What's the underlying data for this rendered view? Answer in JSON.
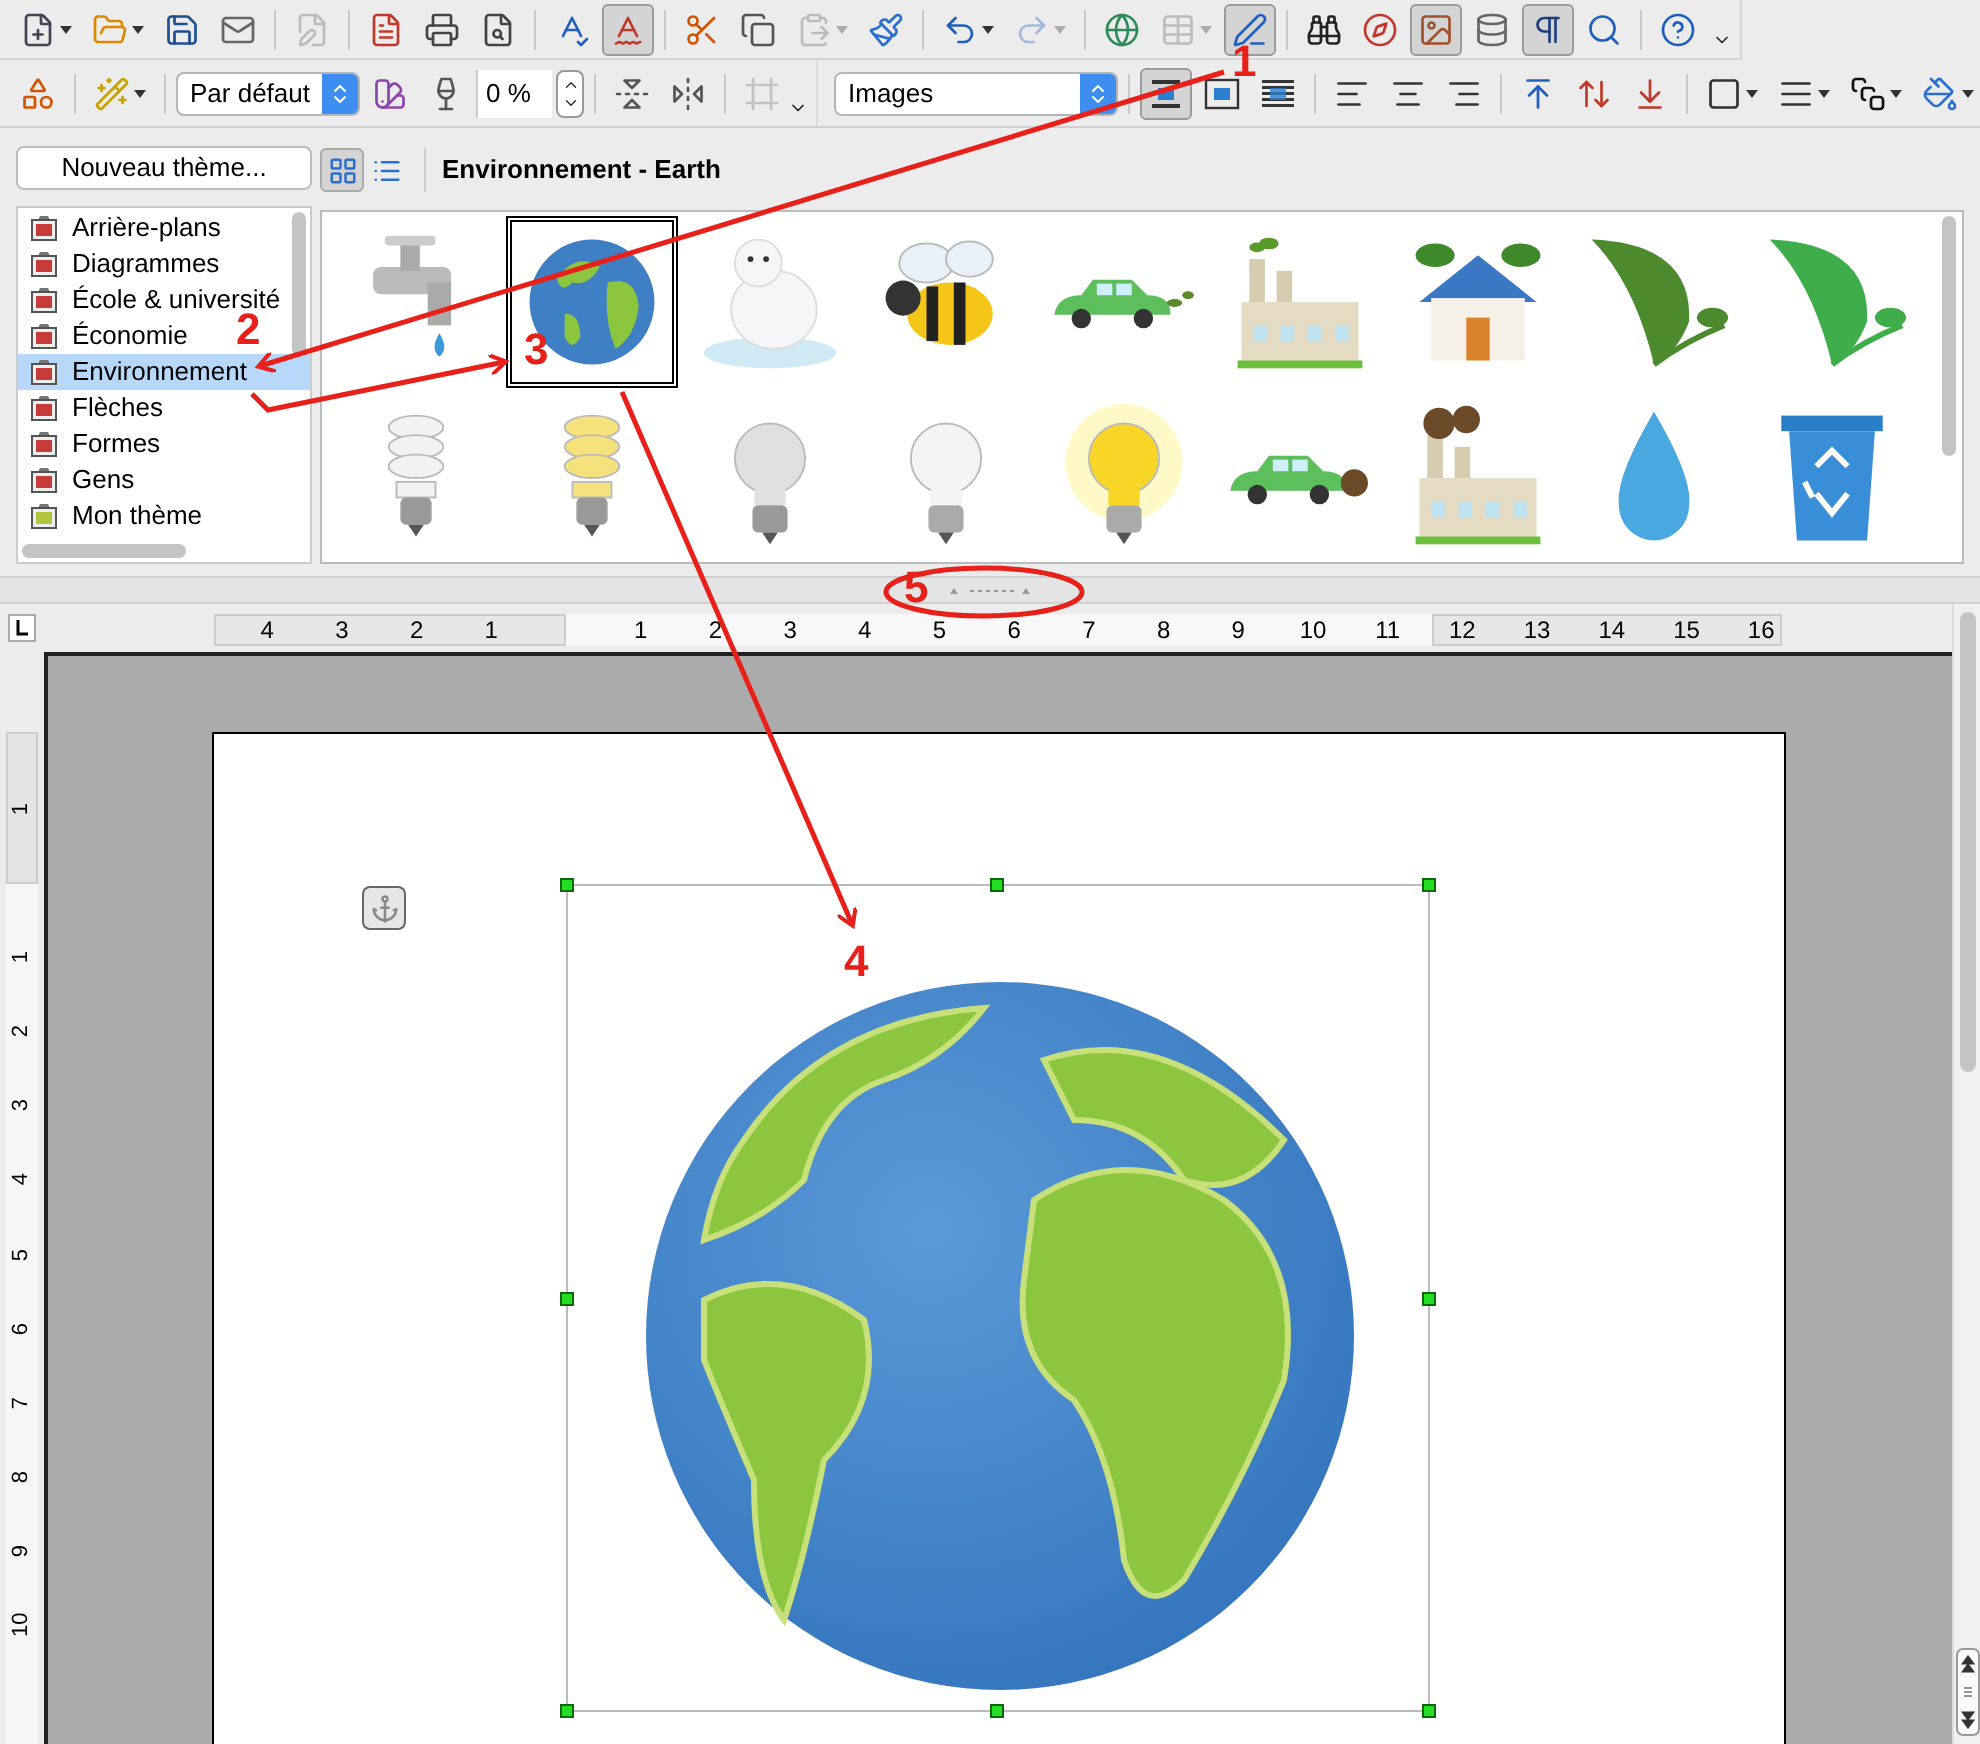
{
  "toolbar_standard": {
    "groups": [
      [
        {
          "menu": true,
          "pressed": false,
          "disabled": false
        },
        {
          "menu": true,
          "pressed": false,
          "disabled": false
        },
        {
          "menu": false,
          "pressed": false,
          "disabled": false
        },
        {
          "menu": false,
          "pressed": false,
          "disabled": false
        }
      ],
      [
        {
          "menu": false,
          "pressed": false,
          "disabled": true
        }
      ],
      [
        {
          "menu": false,
          "pressed": false,
          "disabled": false
        },
        {
          "menu": false,
          "pressed": false,
          "disabled": false
        },
        {
          "menu": false,
          "pressed": false,
          "disabled": false
        }
      ],
      [
        {
          "menu": false,
          "pressed": false,
          "disabled": false
        },
        {
          "menu": false,
          "pressed": true,
          "disabled": false
        }
      ],
      [
        {
          "menu": false,
          "pressed": false,
          "disabled": false
        },
        {
          "menu": false,
          "pressed": false,
          "disabled": false
        },
        {
          "menu": true,
          "pressed": false,
          "disabled": true
        },
        {
          "menu": false,
          "pressed": false,
          "disabled": false
        }
      ],
      [
        {
          "menu": true,
          "pressed": false,
          "disabled": false
        },
        {
          "menu": true,
          "pressed": false,
          "disabled": true
        }
      ],
      [
        {
          "menu": false,
          "pressed": false,
          "disabled": false
        },
        {
          "menu": true,
          "pressed": false,
          "disabled": true
        },
        {
          "menu": false,
          "pressed": true,
          "disabled": false
        }
      ],
      [
        {
          "menu": false,
          "pressed": false,
          "disabled": false
        },
        {
          "menu": false,
          "pressed": false,
          "disabled": false
        },
        {
          "menu": false,
          "pressed": true,
          "disabled": false
        },
        {
          "menu": false,
          "pressed": false,
          "disabled": false
        },
        {
          "menu": false,
          "pressed": true,
          "disabled": false
        },
        {
          "menu": false,
          "pressed": false,
          "disabled": false
        }
      ],
      [
        {
          "menu": false,
          "pressed": false,
          "disabled": false
        }
      ]
    ]
  },
  "toolbar_frame": {
    "groups": [
      [
        {
          "kind": "button",
          "menu": false,
          "pressed": false,
          "disabled": false
        }
      ],
      [
        {
          "kind": "button",
          "menu": true,
          "pressed": false,
          "disabled": false
        }
      ],
      [
        {
          "kind": "select",
          "value": "Par défaut"
        },
        {
          "kind": "button",
          "menu": false,
          "pressed": false,
          "disabled": false
        },
        {
          "kind": "button",
          "menu": false,
          "pressed": false,
          "disabled": false
        },
        {
          "kind": "field",
          "value": "0 %"
        },
        {
          "kind": "spinner"
        }
      ],
      [
        {
          "kind": "button",
          "menu": false,
          "pressed": false,
          "disabled": false
        },
        {
          "kind": "button",
          "menu": false,
          "pressed": false,
          "disabled": false
        }
      ],
      [
        {
          "kind": "button",
          "menu": false,
          "pressed": false,
          "disabled": true
        }
      ]
    ]
  },
  "toolbar_image": {
    "groups": [
      [
        {
          "kind": "select",
          "value": "Images"
        }
      ],
      [
        {
          "kind": "button",
          "menu": false,
          "pressed": true,
          "disabled": false
        },
        {
          "kind": "button",
          "menu": false,
          "pressed": false,
          "disabled": false
        },
        {
          "kind": "button",
          "menu": false,
          "pressed": false,
          "disabled": false
        }
      ],
      [
        {
          "kind": "button",
          "menu": false,
          "pressed": false,
          "disabled": false
        },
        {
          "kind": "button",
          "menu": false,
          "pressed": false,
          "disabled": false
        },
        {
          "kind": "button",
          "menu": false,
          "pressed": false,
          "disabled": false
        }
      ],
      [
        {
          "kind": "button",
          "menu": false,
          "pressed": false,
          "disabled": false
        },
        {
          "kind": "button",
          "menu": false,
          "pressed": false,
          "disabled": false
        },
        {
          "kind": "button",
          "menu": false,
          "pressed": false,
          "disabled": false
        }
      ],
      [
        {
          "kind": "button",
          "menu": true,
          "pressed": false,
          "disabled": false
        },
        {
          "kind": "button",
          "menu": true,
          "pressed": false,
          "disabled": false
        },
        {
          "kind": "button",
          "menu": true,
          "pressed": false,
          "disabled": false
        },
        {
          "kind": "button",
          "menu": true,
          "pressed": false,
          "disabled": false
        }
      ]
    ]
  },
  "gallery": {
    "new_theme_button": "Nouveau thème...",
    "themes": [
      {
        "label": "Arrière-plans",
        "selected": false,
        "color": "#c83c3c"
      },
      {
        "label": "Diagrammes",
        "selected": false,
        "color": "#c83c3c"
      },
      {
        "label": "École & université",
        "selected": false,
        "color": "#c83c3c"
      },
      {
        "label": "Économie",
        "selected": false,
        "color": "#c83c3c"
      },
      {
        "label": "Environnement",
        "selected": true,
        "color": "#c83c3c"
      },
      {
        "label": "Flèches",
        "selected": false,
        "color": "#c83c3c"
      },
      {
        "label": "Formes",
        "selected": false,
        "color": "#c83c3c"
      },
      {
        "label": "Gens",
        "selected": false,
        "color": "#c83c3c"
      },
      {
        "label": "Mon thème",
        "selected": false,
        "color": "#b4c43c"
      }
    ],
    "view_buttons": [
      {
        "selected": true
      },
      {
        "selected": false
      }
    ],
    "title": "Environnement - Earth",
    "items": [
      {
        "selected": false
      },
      {
        "selected": true
      },
      {
        "selected": false
      },
      {
        "selected": false
      },
      {
        "selected": false
      },
      {
        "selected": false
      },
      {
        "selected": false
      },
      {
        "selected": false
      },
      {
        "selected": false
      },
      {
        "selected": false
      },
      {
        "selected": false
      },
      {
        "selected": false
      },
      {
        "selected": false
      },
      {
        "selected": false
      },
      {
        "selected": false
      },
      {
        "selected": false
      },
      {
        "selected": false
      },
      {
        "selected": false
      }
    ]
  },
  "horizontal_ruler": {
    "labels": [
      "4",
      "3",
      "2",
      "1",
      "1",
      "2",
      "3",
      "4",
      "5",
      "6",
      "7",
      "8",
      "9",
      "10",
      "11",
      "12",
      "13",
      "14",
      "15",
      "16"
    ]
  },
  "vertical_ruler": {
    "labels": [
      "1",
      "1",
      "2",
      "3",
      "4",
      "5",
      "6",
      "7",
      "8",
      "9",
      "10"
    ]
  },
  "annotations": [
    {
      "label": "1"
    },
    {
      "label": "2"
    },
    {
      "label": "3"
    },
    {
      "label": "4"
    },
    {
      "label": "5"
    }
  ]
}
